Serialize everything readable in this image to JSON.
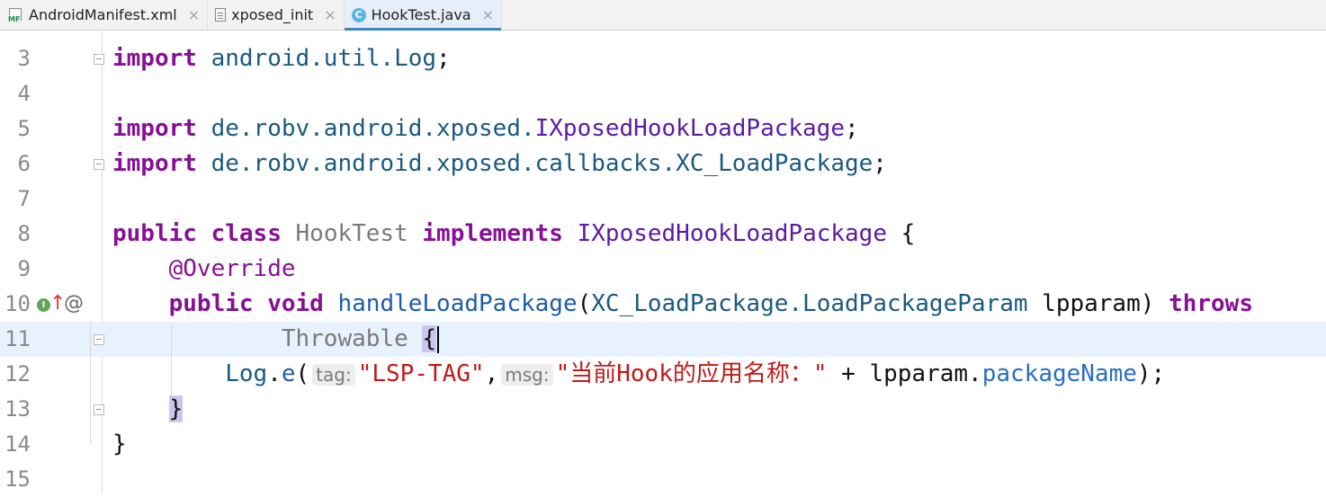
{
  "tabs": [
    {
      "label": "AndroidManifest.xml",
      "icon": "manifest-file-icon",
      "close": "×"
    },
    {
      "label": "xposed_init",
      "icon": "text-file-icon",
      "close": "×"
    },
    {
      "label": "HookTest.java",
      "icon": "java-class-icon",
      "close": "×",
      "active": true
    }
  ],
  "editor": {
    "lines": [
      {
        "num": "3",
        "tokens": [
          [
            "kw",
            "import"
          ],
          [
            "plain",
            " "
          ],
          [
            "pkg",
            "android.util.Log"
          ],
          [
            "plain",
            ";"
          ]
        ]
      },
      {
        "num": "4",
        "tokens": []
      },
      {
        "num": "5",
        "tokens": [
          [
            "kw",
            "import"
          ],
          [
            "plain",
            " "
          ],
          [
            "pkg",
            "de.robv.android.xposed."
          ],
          [
            "iface",
            "IXposedHookLoadPackage"
          ],
          [
            "plain",
            ";"
          ]
        ]
      },
      {
        "num": "6",
        "tokens": [
          [
            "kw",
            "import"
          ],
          [
            "plain",
            " "
          ],
          [
            "pkg",
            "de.robv.android.xposed.callbacks.XC_LoadPackage"
          ],
          [
            "plain",
            ";"
          ]
        ]
      },
      {
        "num": "7",
        "tokens": []
      },
      {
        "num": "8",
        "tokens": [
          [
            "kw",
            "public"
          ],
          [
            "plain",
            " "
          ],
          [
            "kw",
            "class"
          ],
          [
            "plain",
            " "
          ],
          [
            "cls",
            "HookTest"
          ],
          [
            "plain",
            " "
          ],
          [
            "kw",
            "implements"
          ],
          [
            "plain",
            " "
          ],
          [
            "iface",
            "IXposedHookLoadPackage"
          ],
          [
            "plain",
            " {"
          ]
        ]
      },
      {
        "num": "9",
        "tokens": [
          [
            "plain",
            "    "
          ],
          [
            "ann",
            "@Override"
          ]
        ]
      },
      {
        "num": "10",
        "tokens": [
          [
            "plain",
            "    "
          ],
          [
            "kw",
            "public"
          ],
          [
            "plain",
            " "
          ],
          [
            "kw",
            "void"
          ],
          [
            "plain",
            " "
          ],
          [
            "meth",
            "handleLoadPackage"
          ],
          [
            "plain",
            "("
          ],
          [
            "pkg",
            "XC_LoadPackage.LoadPackageParam"
          ],
          [
            "plain",
            " lpparam) "
          ],
          [
            "kw",
            "throws"
          ]
        ]
      },
      {
        "num": "11",
        "tokens": [
          [
            "plain",
            "            "
          ],
          [
            "cls",
            "Throwable"
          ],
          [
            "plain",
            " "
          ],
          [
            "brace",
            "{"
          ],
          [
            "caret",
            ""
          ]
        ]
      },
      {
        "num": "12",
        "tokens": [
          [
            "plain",
            "        "
          ],
          [
            "pkg",
            "Log"
          ],
          [
            "plain",
            "."
          ],
          [
            "meth",
            "e"
          ],
          [
            "plain",
            "("
          ],
          [
            "hint",
            "tag:"
          ],
          [
            "str",
            "\"LSP-TAG\""
          ],
          [
            "plain",
            ","
          ],
          [
            "hint",
            "msg:"
          ],
          [
            "str",
            "\"当前Hook的应用名称：\""
          ],
          [
            "plain",
            " + lpparam."
          ],
          [
            "field",
            "packageName"
          ],
          [
            "plain",
            ");"
          ]
        ]
      },
      {
        "num": "13",
        "tokens": [
          [
            "plain",
            "    "
          ],
          [
            "brace",
            "}"
          ]
        ]
      },
      {
        "num": "14",
        "tokens": [
          [
            "plain",
            "}"
          ]
        ]
      },
      {
        "num": "15",
        "tokens": []
      }
    ],
    "current_line": "11",
    "gutter_markers": {
      "implements_icon": "I",
      "override_arrow": "↑",
      "annotation_at": "@"
    }
  }
}
